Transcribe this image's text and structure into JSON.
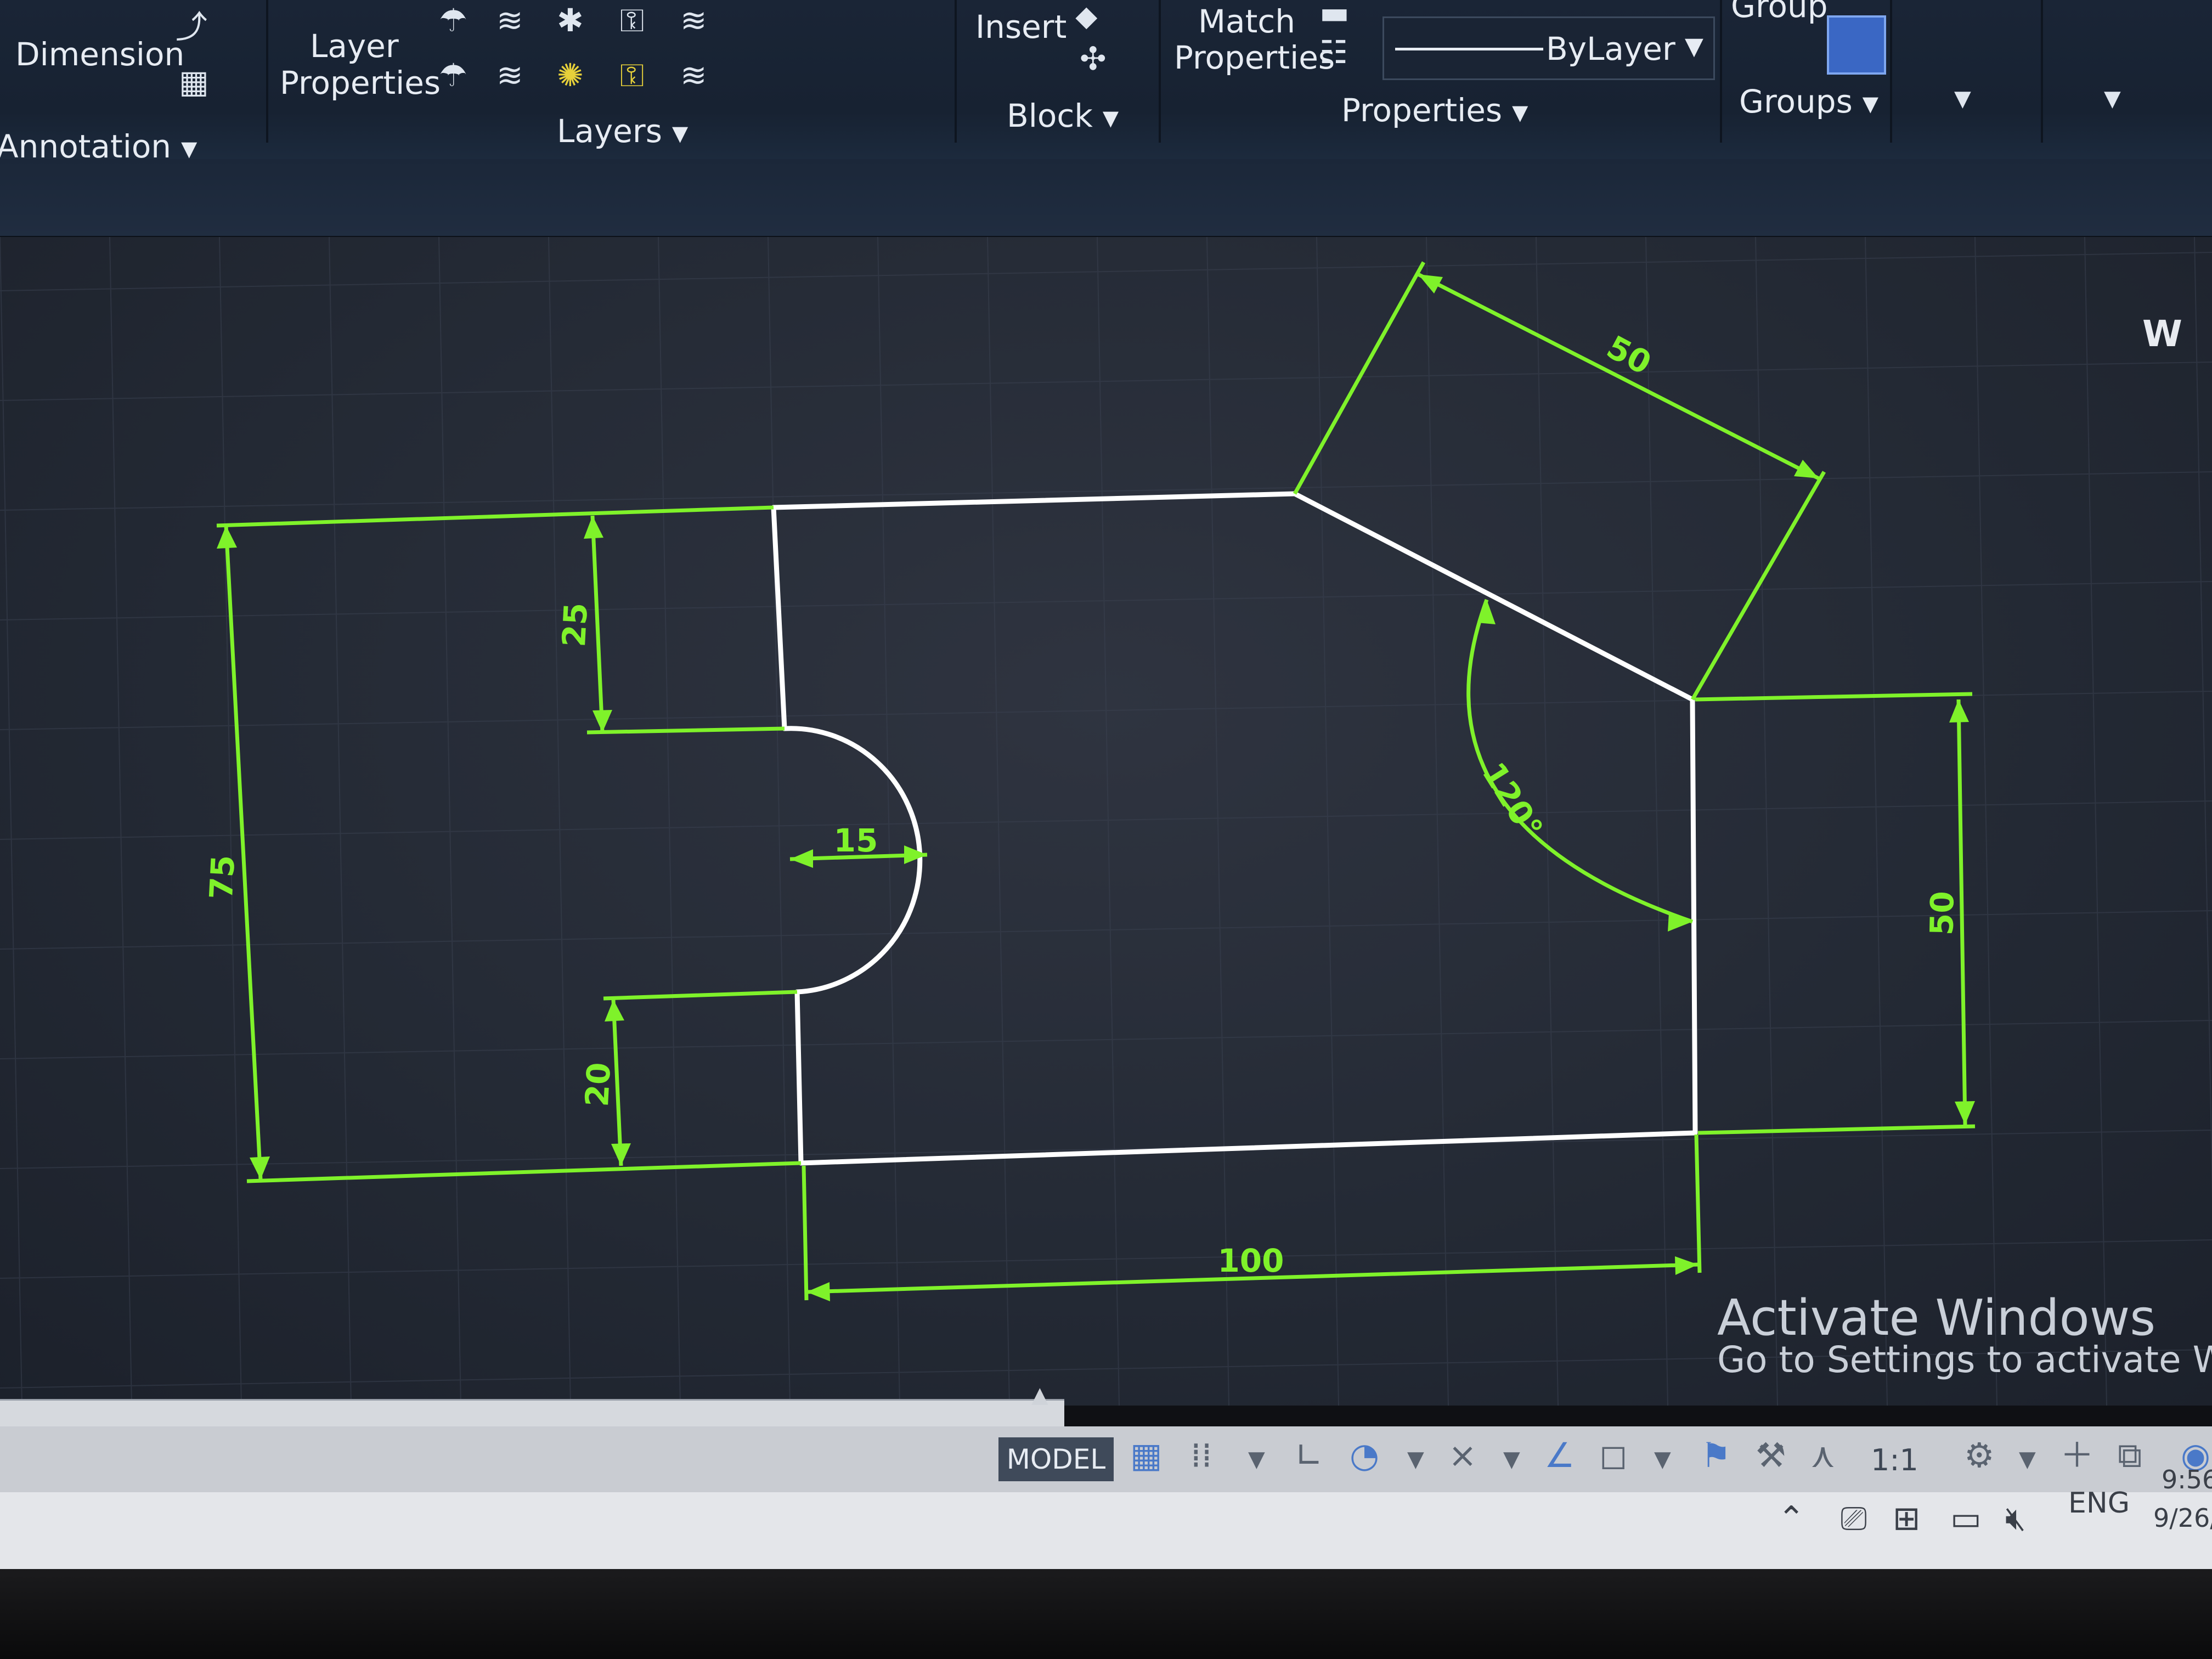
{
  "ribbon": {
    "panels": {
      "annotation": "Annotation",
      "layers": "Layers",
      "block": "Block",
      "properties": "Properties",
      "groups": "Groups"
    },
    "buttons": {
      "dimension": "Dimension",
      "layer_properties_1": "Layer",
      "layer_properties_2": "Properties",
      "insert": "Insert",
      "match_properties_1": "Match",
      "match_properties_2": "Properties",
      "group": "Group"
    },
    "bylayer_value": "ByLayer",
    "icons": [
      "table-icon",
      "layer-tool-icons",
      "insert-icon",
      "match-properties-icon",
      "select-cursor-icon"
    ]
  },
  "drawing": {
    "dimensions": {
      "overall_height": "75",
      "top_notch": "25",
      "bottom_notch": "20",
      "arc_radius": "15",
      "slant_length": "50",
      "angle": "120°",
      "right_height": "50",
      "base_width": "100"
    },
    "colors": {
      "dimension": "#7ff22a",
      "outline": "#ffffff",
      "background": "#262b35"
    }
  },
  "viewcube": {
    "letter": "W"
  },
  "watermark": {
    "title": "Activate Windows",
    "subtitle": "Go to Settings to activate Wind"
  },
  "statusbar": {
    "model_tab": "MODEL",
    "scale": "1:1",
    "icons": [
      "grid-icon",
      "snap-icon",
      "ortho-icon",
      "polar-icon",
      "osnap-icon",
      "annotation-scale-icon",
      "workspace-icon",
      "plus-icon"
    ]
  },
  "taskbar": {
    "language": "ENG",
    "time": "9:56",
    "date": "9/26/",
    "icons": [
      "chevron-up-icon",
      "meet-icon",
      "network-icon",
      "display-icon",
      "volume-muted-icon"
    ]
  }
}
